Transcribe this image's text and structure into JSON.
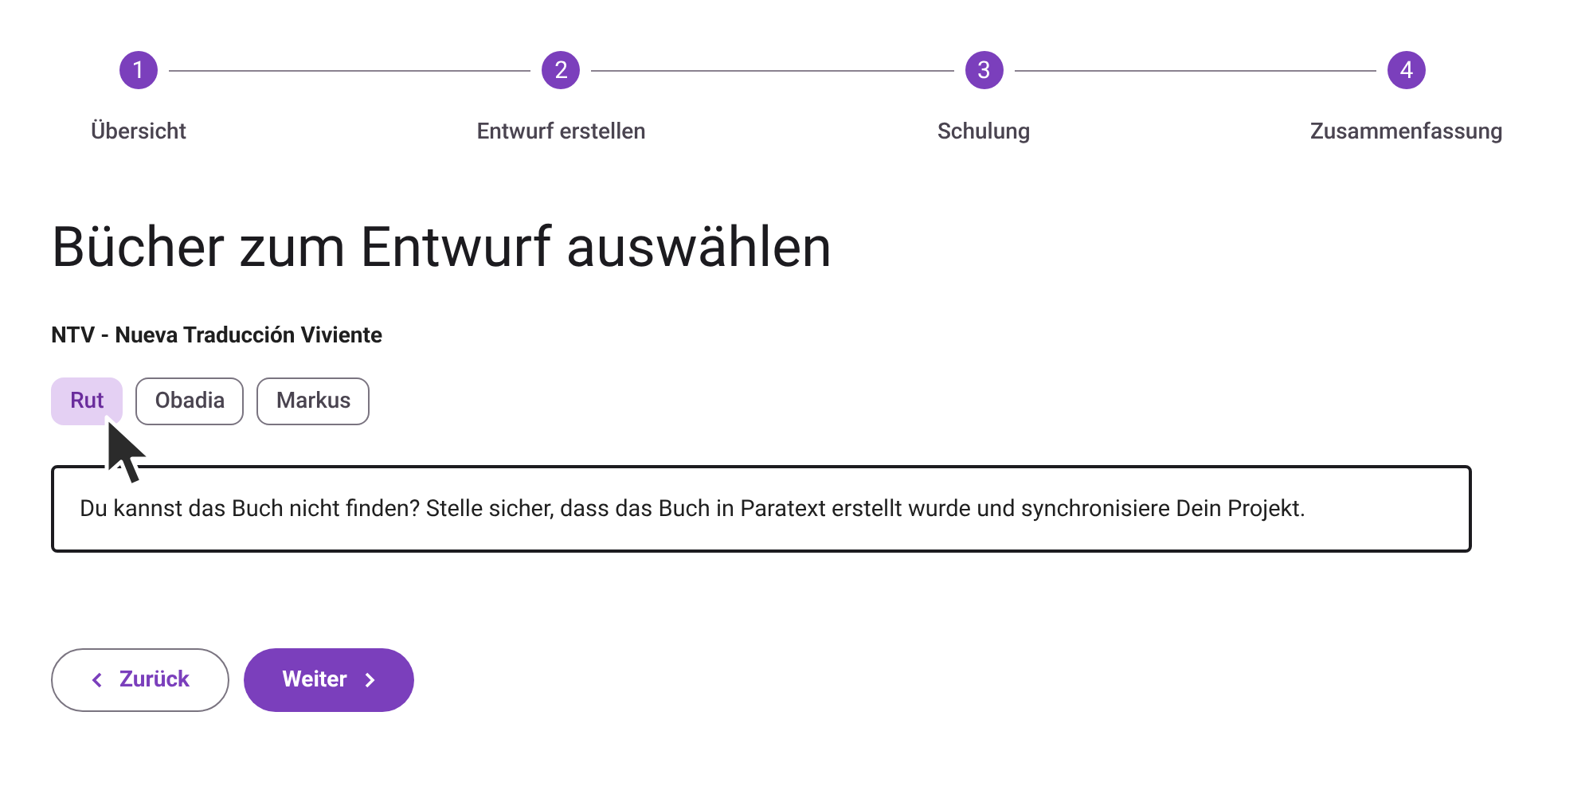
{
  "stepper": {
    "steps": [
      {
        "number": "1",
        "label": "Übersicht"
      },
      {
        "number": "2",
        "label": "Entwurf erstellen"
      },
      {
        "number": "3",
        "label": "Schulung"
      },
      {
        "number": "4",
        "label": "Zusammenfassung"
      }
    ]
  },
  "heading": "Bücher zum Entwurf auswählen",
  "project": "NTV - Nueva Traducción Viviente",
  "books": [
    {
      "label": "Rut",
      "selected": true
    },
    {
      "label": "Obadia",
      "selected": false
    },
    {
      "label": "Markus",
      "selected": false
    }
  ],
  "notice": "Du kannst das Buch nicht finden? Stelle sicher, dass das Buch in Paratext erstellt wurde und synchronisiere Dein Projekt.",
  "buttons": {
    "back": "Zurück",
    "next": "Weiter"
  }
}
